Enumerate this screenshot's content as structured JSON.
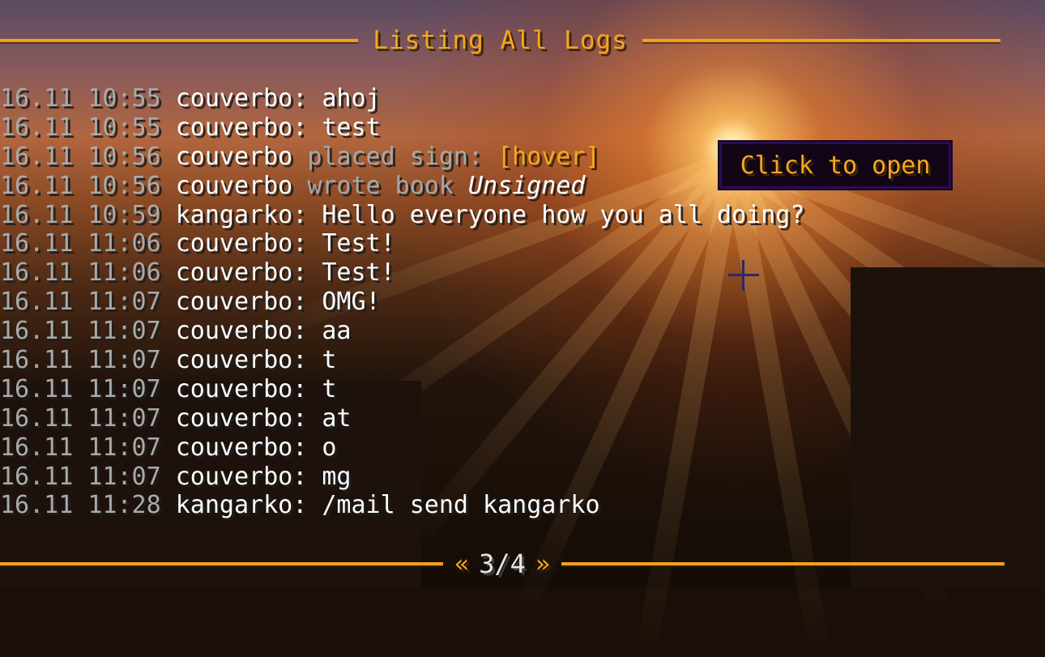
{
  "header": {
    "title": "Listing All Logs"
  },
  "logs": [
    {
      "time": "16.11 10:55",
      "user": "couverbo",
      "sep": ": ",
      "type": "chat",
      "message": "ahoj"
    },
    {
      "time": "16.11 10:55",
      "user": "couverbo",
      "sep": ": ",
      "type": "chat",
      "message": "test"
    },
    {
      "time": "16.11 10:56",
      "user": "couverbo",
      "sep": " ",
      "type": "sign",
      "action": "placed sign: ",
      "link": "[hover]"
    },
    {
      "time": "16.11 10:56",
      "user": "couverbo",
      "sep": " ",
      "type": "book",
      "action": "wrote book ",
      "book": "Unsigned"
    },
    {
      "time": "16.11 10:59",
      "user": "kangarko",
      "sep": ": ",
      "type": "chat",
      "message": "Hello everyone how you all doing?"
    },
    {
      "time": "16.11 11:06",
      "user": "couverbo",
      "sep": ": ",
      "type": "chat",
      "message": "Test!"
    },
    {
      "time": "16.11 11:06",
      "user": "couverbo",
      "sep": ": ",
      "type": "chat",
      "message": "Test!"
    },
    {
      "time": "16.11 11:07",
      "user": "couverbo",
      "sep": ": ",
      "type": "chat",
      "message": "OMG!"
    },
    {
      "time": "16.11 11:07",
      "user": "couverbo",
      "sep": ": ",
      "type": "chat",
      "message": "aa"
    },
    {
      "time": "16.11 11:07",
      "user": "couverbo",
      "sep": ": ",
      "type": "chat",
      "message": "t"
    },
    {
      "time": "16.11 11:07",
      "user": "couverbo",
      "sep": ": ",
      "type": "chat",
      "message": "t"
    },
    {
      "time": "16.11 11:07",
      "user": "couverbo",
      "sep": ": ",
      "type": "chat",
      "message": "at"
    },
    {
      "time": "16.11 11:07",
      "user": "couverbo",
      "sep": ": ",
      "type": "chat",
      "message": "o"
    },
    {
      "time": "16.11 11:07",
      "user": "couverbo",
      "sep": ": ",
      "type": "chat",
      "message": "mg"
    },
    {
      "time": "16.11 11:28",
      "user": "kangarko",
      "sep": ": ",
      "type": "chat",
      "message": "/mail send kangarko"
    }
  ],
  "tooltip": {
    "text": "Click to open"
  },
  "footer": {
    "prev": "«",
    "page": "3/4",
    "next": "»"
  },
  "icons": {
    "crosshair": "crosshair-icon"
  },
  "colors": {
    "accent": "#f5a623",
    "timestamp": "#aaaaaa",
    "action": "#a8a8a8",
    "text": "#ffffff",
    "tooltip_border": "#2a0b5a"
  }
}
